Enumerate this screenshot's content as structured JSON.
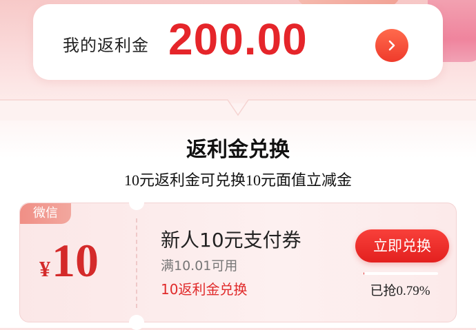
{
  "colors": {
    "accent": "#e5252a",
    "button": "#e3201f",
    "tag": "#f08f86",
    "coupon_bg": "#fbe7e7"
  },
  "balance": {
    "label": "我的返利金",
    "amount": "200.00",
    "arrow_icon": "chevron-right-icon"
  },
  "exchange": {
    "title": "返利金兑换",
    "subtitle": "10元返利金可兑换10元面值立减金"
  },
  "coupon": {
    "tag": "微信",
    "currency": "¥",
    "value": "10",
    "name": "新人10元支付券",
    "condition": "满10.01可用",
    "cost": "10返利金兑换",
    "redeem_label": "立即兑换",
    "grabbed_text": "已抢0.79%",
    "grabbed_percent": 0.79
  }
}
